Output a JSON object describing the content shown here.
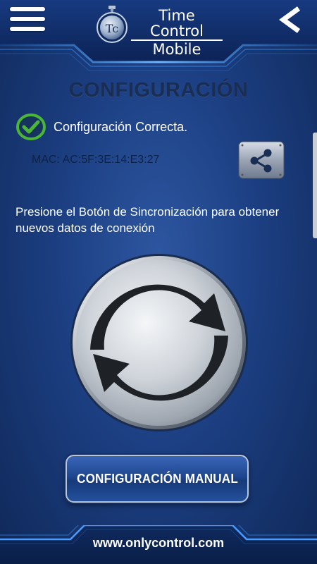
{
  "header": {
    "title_line1": "Time Control",
    "title_line2": "Mobile",
    "logo_text": "Tc",
    "menu_icon": "hamburger-menu-icon",
    "back_icon": "chevron-left-icon"
  },
  "screen": {
    "title": "CONFIGURACIÓN",
    "status_text": "Configuración Correcta.",
    "status_icon": "check-circle-icon",
    "mac": "MAC: AC:5F:3E:14:E3:27",
    "share_icon": "share-icon",
    "instructions": "Presione el Botón de Sincronización para obtener nuevos datos de conexión",
    "sync_icon": "sync-icon",
    "manual_button_label": "CONFIGURACIÓN MANUAL"
  },
  "footer": {
    "website": "www.onlycontrol.com"
  },
  "colors": {
    "background": "#1c3f82",
    "title_dark": "#1a2d52",
    "status_green": "#3fae2a",
    "accent_blue": "#2a6fd6"
  }
}
